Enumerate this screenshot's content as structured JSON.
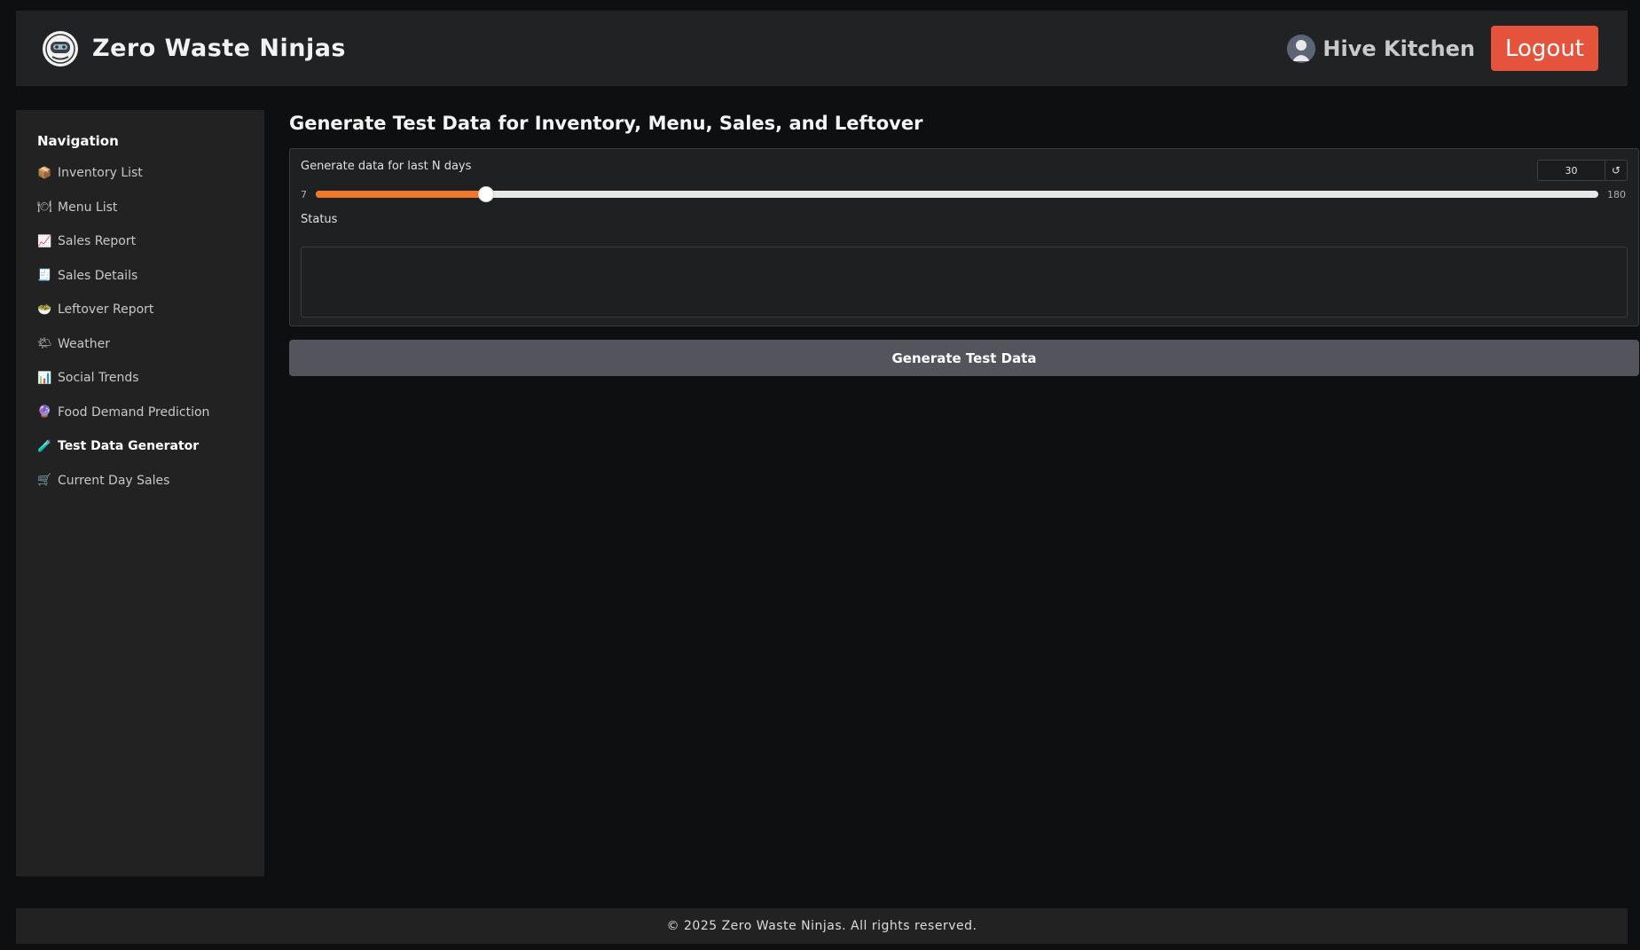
{
  "header": {
    "brand": "Zero Waste Ninjas",
    "user_name": "Hive Kitchen",
    "logout_label": "Logout"
  },
  "sidebar": {
    "heading": "Navigation",
    "items": [
      {
        "label": "Inventory List",
        "icon": "package-icon",
        "glyph": "📦",
        "active": false
      },
      {
        "label": "Menu List",
        "icon": "plate-icon",
        "glyph": "🍽",
        "active": false
      },
      {
        "label": "Sales Report",
        "icon": "chart-up-icon",
        "glyph": "📈",
        "active": false
      },
      {
        "label": "Sales Details",
        "icon": "receipt-icon",
        "glyph": "🧾",
        "active": false
      },
      {
        "label": "Leftover Report",
        "icon": "bowl-icon",
        "glyph": "🥗",
        "active": false
      },
      {
        "label": "Weather",
        "icon": "sun-cloud-icon",
        "glyph": "🌤",
        "active": false
      },
      {
        "label": "Social Trends",
        "icon": "bar-chart-icon",
        "glyph": "📊",
        "active": false
      },
      {
        "label": "Food Demand Prediction",
        "icon": "crystal-ball-icon",
        "glyph": "🔮",
        "active": false
      },
      {
        "label": "Test Data Generator",
        "icon": "test-tube-icon",
        "glyph": "🧪",
        "active": true
      },
      {
        "label": "Current Day Sales",
        "icon": "cart-icon",
        "glyph": "🛒",
        "active": false
      }
    ]
  },
  "main": {
    "title": "Generate Test Data for Inventory, Menu, Sales, and Leftover",
    "slider": {
      "label": "Generate data for last N days",
      "min": "7",
      "max": "180",
      "value": "30",
      "reset_glyph": "↺"
    },
    "status_label": "Status",
    "status_value": "",
    "generate_label": "Generate Test Data"
  },
  "footer": {
    "text": "© 2025 Zero Waste Ninjas. All rights reserved."
  },
  "colors": {
    "accent": "#f07828",
    "logout": "#e5533d",
    "button": "#53545c"
  }
}
